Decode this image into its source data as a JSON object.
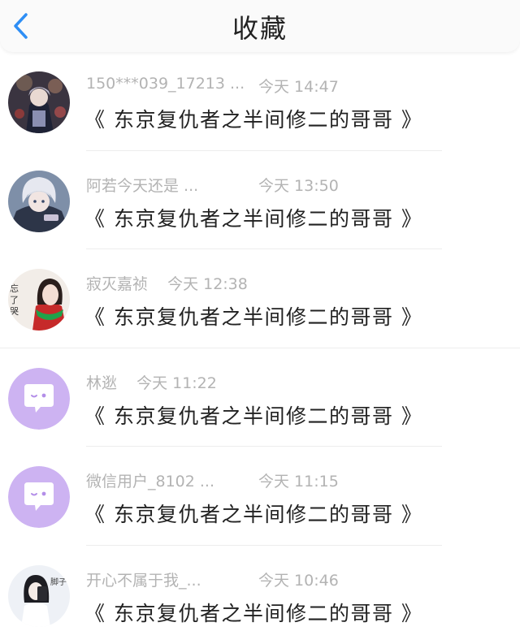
{
  "header": {
    "title": "收藏",
    "back_icon": "chevron-left-icon",
    "accent_color": "#2e8ef5"
  },
  "items": [
    {
      "name": "150***039_17213 ...",
      "time": "今天 14:47",
      "content": "《 东京复仇者之半间修二的哥哥 》",
      "avatar": "anime-portrait-dark"
    },
    {
      "name": "阿若今天还是 ...",
      "time": "今天 13:50",
      "content": "《 东京复仇者之半间修二的哥哥 》",
      "avatar": "anime-portrait-silver-hair"
    },
    {
      "name": "寂灭嘉祯",
      "time": "今天 12:38",
      "content": "《 东京复仇者之半间修二的哥哥 》",
      "avatar": "photo-girl-green-scarf",
      "avatar_text": "忘了哭"
    },
    {
      "name": "林逖",
      "time": "今天 11:22",
      "content": "《 东京复仇者之半间修二的哥哥 》",
      "avatar": "default-chat-bubble-avatar"
    },
    {
      "name": "微信用户_8102 ...",
      "time": "今天 11:15",
      "content": "《 东京复仇者之半间修二的哥哥 》",
      "avatar": "default-chat-bubble-avatar"
    },
    {
      "name": "开心不属于我_...",
      "time": "今天 10:46",
      "content": "《 东京复仇者之半间修二的哥哥 》",
      "avatar": "photo-selfie-girl",
      "avatar_text": "脚子"
    }
  ],
  "colors": {
    "default_avatar_bg": "#cdb3f2",
    "meta_text": "#b3b3b3",
    "content_text": "#222222"
  }
}
